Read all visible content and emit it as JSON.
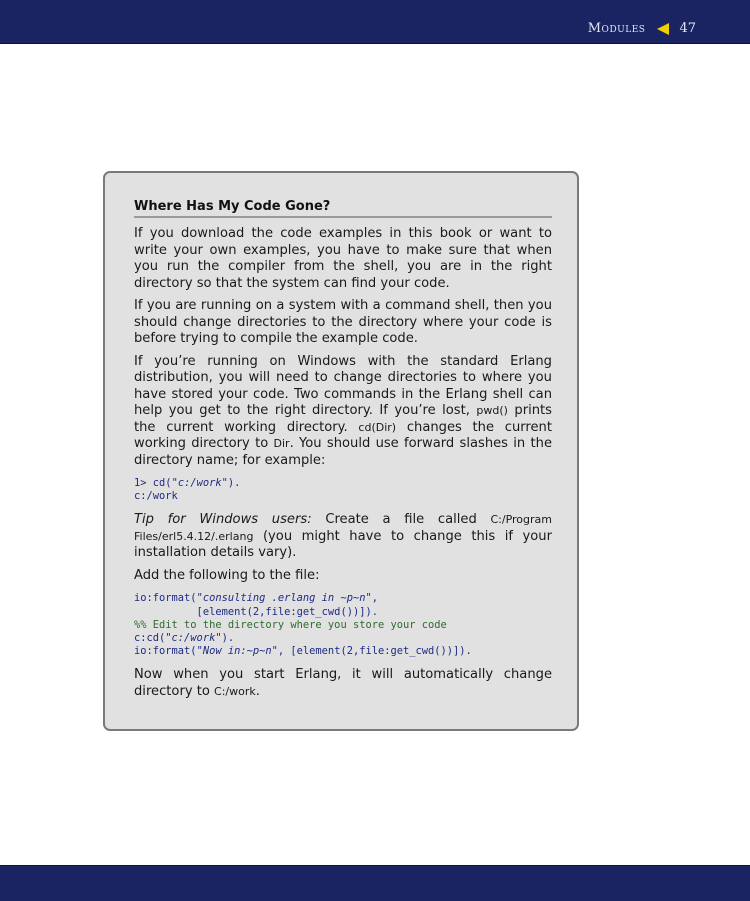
{
  "header": {
    "section_title": "Modules",
    "page_number": "47",
    "arrow_icon": "left-triangle-arrow",
    "arrow_color": "#f3d000",
    "bar_color": "#1a2462"
  },
  "sidebar": {
    "title": "Where Has My Code Gone?",
    "para1": "If you download the code examples in this book or want to write your own examples, you have to make sure that when you run the compiler from the shell, you are in the right directory so that the system can find your code.",
    "para2": "If you are running on a system with a command shell, then you should change directories to the directory where your code is before trying to compile the example code.",
    "para3": {
      "text1": "If you’re running on Windows with the standard Erlang distribution, you will need to change directories to where you have stored your code. Two commands in the Erlang shell can help you get to the right directory. If you’re lost, ",
      "code1": "pwd()",
      "text2": " prints the current working directory. ",
      "code2": "cd(Dir)",
      "text3": " changes the current working directory to ",
      "code3": "Dir",
      "text4": ". You should use forward slashes in the directory name; for example:"
    },
    "code_example_1": {
      "prompt": "1> ",
      "fn": "cd(",
      "arg": "\"c:/work\"",
      "close": ").",
      "output": "c:/work"
    },
    "para4": {
      "tip_label": "Tip for Windows users:",
      "text1": " Create a file called ",
      "path": "C:/Program Files/erl5.4.12/.erlang",
      "text2": " (you might have to change this if your installation details vary)."
    },
    "para5": "Add the following to the file:",
    "code_example_2": {
      "l1_fn": "io:format(",
      "l1_str": "\"consulting .erlang in ~p~n\"",
      "l1_end": ",",
      "l2": "          [element(2,file:get_cwd())]).",
      "l3_comment": "%% Edit to the directory where you store your code",
      "l4_fn": "c:cd(",
      "l4_str": "\"c:/work\"",
      "l4_end": ").",
      "l5_fn": "io:format(",
      "l5_str": "\"Now in:~p~n\"",
      "l5_end": ", [element(2,file:get_cwd())])."
    },
    "para6": {
      "text1": "Now when you start Erlang, it will automatically change directory to ",
      "path": "C:/work",
      "text2": "."
    }
  }
}
